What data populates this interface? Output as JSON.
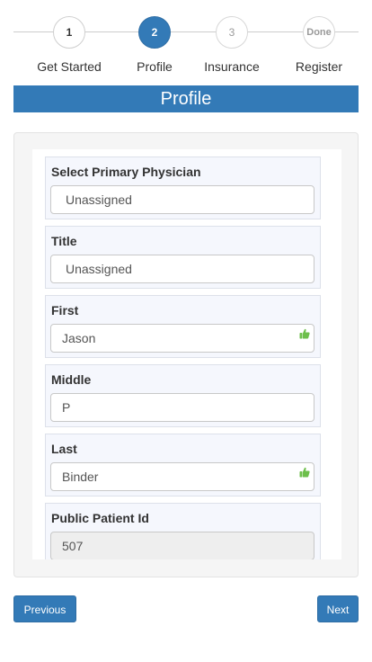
{
  "stepper": {
    "steps": [
      {
        "number": "1",
        "label": "Get Started"
      },
      {
        "number": "2",
        "label": "Profile"
      },
      {
        "number": "3",
        "label": "Insurance"
      },
      {
        "number": "Done",
        "label": "Register"
      }
    ],
    "active_index": 1
  },
  "banner": {
    "title": "Profile"
  },
  "form": {
    "fields": [
      {
        "label": "Select Primary Physician",
        "value": "Unassigned"
      },
      {
        "label": "Title",
        "value": "Unassigned"
      },
      {
        "label": "First",
        "value": "Jason"
      },
      {
        "label": "Middle",
        "value": "P"
      },
      {
        "label": "Last",
        "value": "Binder"
      },
      {
        "label": "Public Patient Id",
        "value": "507"
      }
    ]
  },
  "buttons": {
    "previous": "Previous",
    "next": "Next"
  },
  "colors": {
    "primary": "#337ab7",
    "valid": "#6dbf4b"
  },
  "icons": {
    "valid": "thumbs-up-icon"
  }
}
